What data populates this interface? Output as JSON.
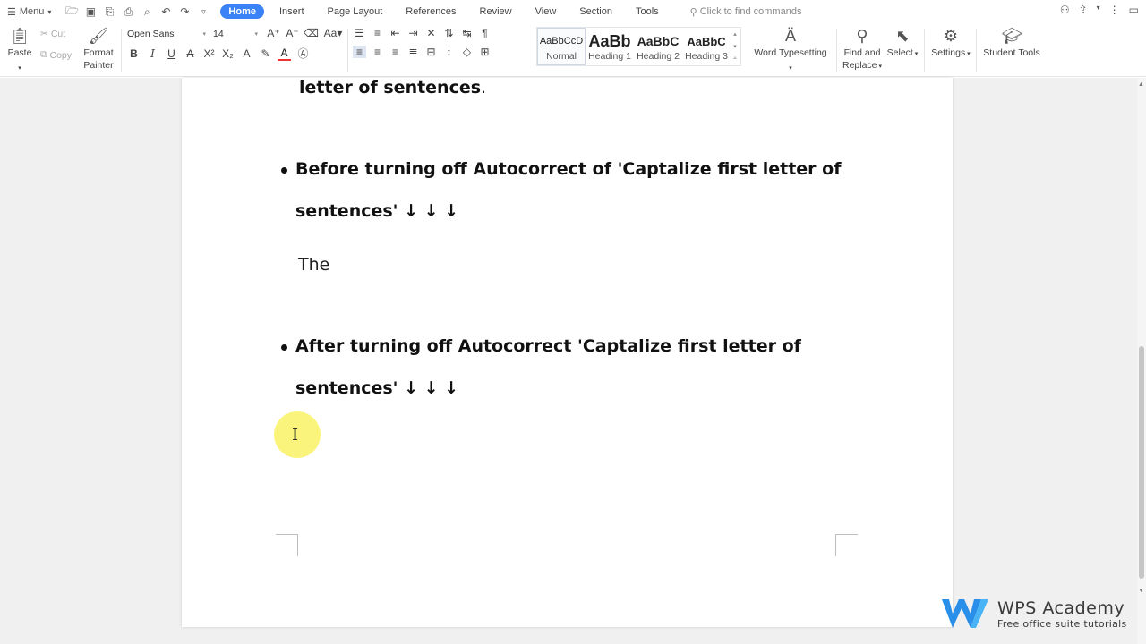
{
  "menubar": {
    "menu_label": "Menu",
    "tabs": [
      "Home",
      "Insert",
      "Page Layout",
      "References",
      "Review",
      "View",
      "Section",
      "Tools"
    ],
    "search_placeholder": "Click to find commands"
  },
  "ribbon": {
    "paste": "Paste",
    "cut": "Cut",
    "copy": "Copy",
    "format_painter_line1": "Format",
    "format_painter_line2": "Painter",
    "font_name": "Open Sans",
    "font_size": "14",
    "styles": [
      {
        "preview": "AaBbCcD",
        "name": "Normal"
      },
      {
        "preview": "AaBb",
        "name": "Heading 1"
      },
      {
        "preview": "AaBbC",
        "name": "Heading 2"
      },
      {
        "preview": "AaBbC",
        "name": "Heading 3"
      }
    ],
    "word_typesetting": "Word Typesetting",
    "find_replace_line1": "Find and",
    "find_replace_line2": "Replace",
    "select": "Select",
    "settings": "Settings",
    "student_tools": "Student Tools"
  },
  "document": {
    "top_fragment": "letter of sentences",
    "top_fragment_period": ".",
    "bullet1_line1": "Before turning off Autocorrect of 'Captalize first letter of",
    "bullet1_line2": "sentences' ↓ ↓ ↓",
    "plain_text": "The",
    "bullet2_line1": "After turning off Autocorrect 'Captalize first letter of",
    "bullet2_line2": "sentences' ↓ ↓ ↓"
  },
  "watermark": {
    "title": "WPS Academy",
    "subtitle": "Free office suite tutorials"
  },
  "colors": {
    "accent": "#3b82f6",
    "cursor_highlight": "#faf050",
    "logo_blue": "#2a8fe8"
  }
}
